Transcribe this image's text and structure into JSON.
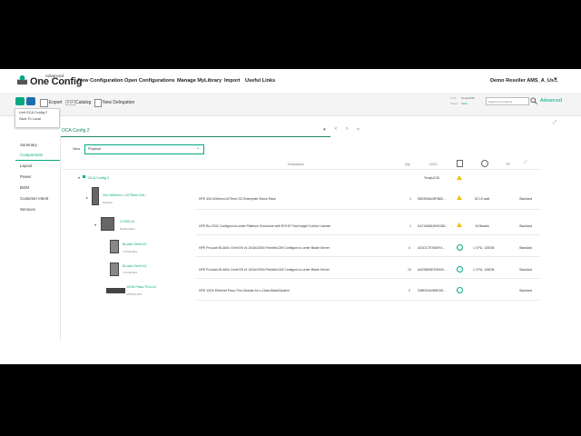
{
  "app": {
    "logo_small": "Advanced",
    "logo_main": "One Config",
    "nav": [
      "New Configuration",
      "Open Configurations",
      "Manage MyLibrary",
      "Import",
      "Useful Links"
    ],
    "user": "Demo Reseller AMS_A_Us..."
  },
  "toolbar": {
    "export": "Export",
    "export_badge": "EXP",
    "catalog": "Catalog",
    "new_delegation": "New Delegation",
    "status_label1": "GOS",
    "status_value1": "TempUCID",
    "status_label2": "Status",
    "status_value2": "Valid",
    "search_placeholder": "Search for products",
    "advanced": "Advanced",
    "menu_items": [
      "Unit OCA Config 2",
      "Save To Local"
    ]
  },
  "config": {
    "title": "OCA Config 2",
    "view_label": "View",
    "view_value": "Physical"
  },
  "sidebar": {
    "items": [
      "Summary",
      "Components",
      "Layout",
      "Power",
      "BOM",
      "Customer Intent",
      "Services"
    ],
    "active": "Components"
  },
  "table": {
    "headers": {
      "description": "Description",
      "qty": "Qty",
      "ucid": "UCID",
      "tr": "TR"
    },
    "root": {
      "name": "OCA Config 2",
      "ucid": "TempUCID"
    },
    "rows": [
      {
        "name": "42U 600mm x 1075mm Ent...",
        "sku": "P9K40A",
        "desc": "HPE 42U 600mmx1075mm G2 Enterprise Shock Rack",
        "qty": "1",
        "ucid": "S6D5K6A05P66D...",
        "power": "52.19 watt",
        "support": "Standard"
      },
      {
        "name": "C7000 #1",
        "sku": "681844-B21",
        "desc": "HPE BLc7000 Configure-to-order Platinum Enclosure with ROHS Trial Insight Control License",
        "qty": "1",
        "ucid": "EA72468A3H9G8D...",
        "power": "16 Blades",
        "support": "Standard"
      },
      {
        "name": "BLade Gen9 #2",
        "sku": "727030-B21",
        "desc": "HPE ProLiant BL460c Gen9 E5 v4 10Gb/20Gb FlexibleLOM Configure-to-order Blade Server",
        "qty": "4",
        "ucid": "4D1DC7E9ID0F4...",
        "power": "1 CPU, 128GB",
        "support": "Standard"
      },
      {
        "name": "BLade Gen9 #1",
        "sku": "727030-B21",
        "desc": "HPE ProLiant BL460c Gen9 E5 v4 10Gb/20Gb FlexibleLOM Configure-to-order Blade Server",
        "qty": "12",
        "ucid": "AA2D8E8EE9D0D...",
        "power": "1 CPU, 128GB",
        "support": "Standard"
      },
      {
        "name": "10Gb Pass-Thru #1",
        "sku": "AP870A-B21",
        "desc": "HPE 10Gb Ethernet Pass-Thru Module for c-Class BladeSystem",
        "qty": "2",
        "ucid": "32BE49A4H8D0D...",
        "power": "",
        "support": "Standard"
      }
    ]
  },
  "colors": {
    "accent": "#01a982",
    "warn": "#f0c000"
  }
}
